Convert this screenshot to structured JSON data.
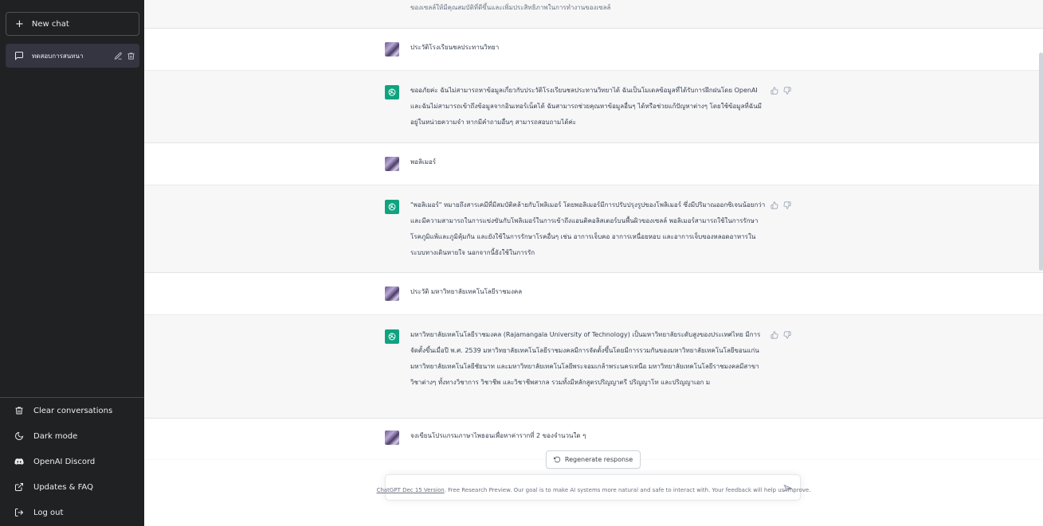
{
  "sidebar": {
    "new_chat_label": "New chat",
    "conversation": {
      "label": "ทดสอบการสนทนา"
    },
    "links": [
      {
        "label": "Clear conversations",
        "icon": "trash-icon"
      },
      {
        "label": "Dark mode",
        "icon": "moon-icon"
      },
      {
        "label": "OpenAI Discord",
        "icon": "discord-icon"
      },
      {
        "label": "Updates & FAQ",
        "icon": "external-link-icon"
      },
      {
        "label": "Log out",
        "icon": "logout-icon"
      }
    ]
  },
  "chat": {
    "top_partial": "ของเซลล์ให้มีคุณสมบัติที่ดีขึ้นและเพิ่มประสิทธิภาพในการทำงานของเซลล์",
    "messages": [
      {
        "role": "user",
        "text": "ประวัติโรงเรียนชลประทานวิทยา"
      },
      {
        "role": "assistant",
        "text": "ขออภัยค่ะ ฉันไม่สามารถหาข้อมูลเกี่ยวกับประวัติโรงเรียนชลประทานวิทยาได้ ฉันเป็นโมเดลข้อมูลที่ได้รับการฝึกฝนโดย OpenAI และฉันไม่สามารถเข้าถึงข้อมูลจากอินเทอร์เน็ตได้ ฉันสามารถช่วยคุณหาข้อมูลอื่นๆ ได้หรือช่วยแก้ปัญหาต่างๆ โดยใช้ข้อมูลที่ฉันมีอยู่ในหน่วยความจำ หากมีคำถามอื่นๆ สามารถสอบถามได้ค่ะ"
      },
      {
        "role": "user",
        "text": "พอลิเมอร์"
      },
      {
        "role": "assistant",
        "text": "\"พอลิเมอร์\" หมายถึงสารเคมีที่มีสมบัติคล้ายกับโพลิเมอร์ โดยพอลิเมอร์มีการปรับปรุงรูปของโพลิเมอร์ ซึ่งมีปริมาณออกซิเจนน้อยกว่า และมีความสามารถในการแข่งขันกับโพลิเมอร์ในการเข้าถึงแอนติคอลิสเตอร์บนพื้นผิวของเซลล์ พอลิเมอร์สามารถใช้ในการรักษาโรคภูมิแพ้และภูมิคุ้มกัน และยังใช้ในการรักษาโรคอื่นๆ เช่น อาการเจ็บคอ อาการเหนื่อยหอบ และอาการเจ็บของหลอดอาหารในระบบทางเดินหายใจ นอกจากนี้ยังใช้ในการรัก"
      },
      {
        "role": "user",
        "text": "ประวัติ มหาวิทยาลัยเทคโนโลยีราชมงคล"
      },
      {
        "role": "assistant",
        "text": "มหาวิทยาลัยเทคโนโลยีราชมงคล (Rajamangala University of Technology) เป็นมหาวิทยาลัยระดับสูงของประเทศไทย มีการจัดตั้งขึ้นเมื่อปี พ.ศ. 2539 มหาวิทยาลัยเทคโนโลยีราชมงคลมีการจัดตั้งขึ้นโดยมีการรวมกันของมหาวิทยาลัยเทคโนโลยีขอนแก่น มหาวิทยาลัยเทคโนโลยีชัยนาท และมหาวิทยาลัยเทคโนโลยีพระจอมเกล้าพระนครเหนือ มหาวิทยาลัยเทคโนโลยีราชมงคลมีสาขาวิชาต่างๆ ทั้งทางวิชาการ วิชาชีพ และวิชาชีพสากล รวมทั้งมีหลักสูตรปริญญาตรี ปริญญาโท และปริญญาเอก ม"
      },
      {
        "role": "user",
        "text": "จงเขียนโปรแกรมภาษาไพธอนเพื่อหาค่ารากที่ 2 ของจำนวนใด ๆ"
      }
    ],
    "regenerate_label": "Regenerate response",
    "input": {
      "value": "",
      "placeholder": ""
    },
    "footer": {
      "version": "ChatGPT Dec 15 Version",
      "text": ". Free Research Preview. Our goal is to make AI systems more natural and safe to interact with. Your feedback will help us improve."
    }
  },
  "colors": {
    "sidebar_bg": "#202123",
    "sidebar_selected": "#343541",
    "assistant_row_bg": "#f7f7f8",
    "assistant_avatar": "#10a37f"
  }
}
